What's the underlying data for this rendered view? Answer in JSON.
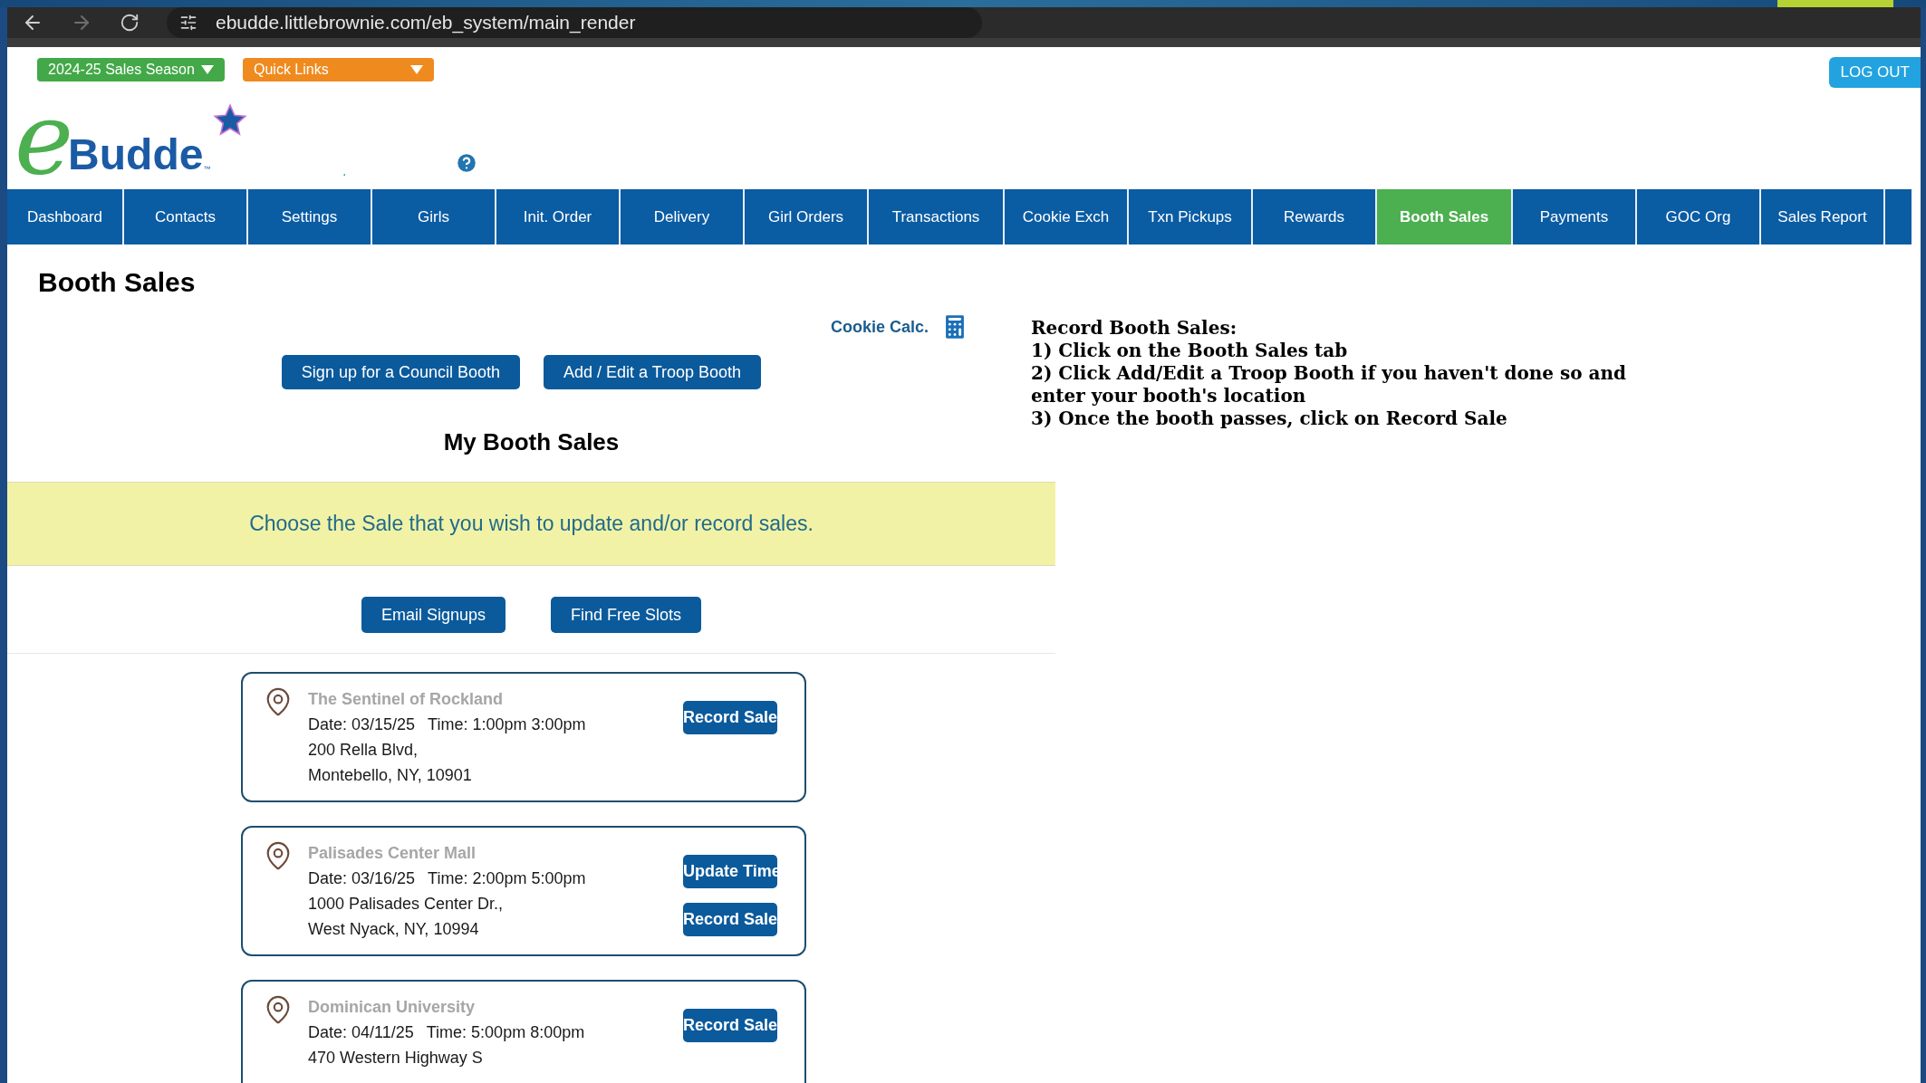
{
  "browser": {
    "url": "ebudde.littlebrownie.com/eb_system/main_render"
  },
  "header": {
    "season": "2024-25 Sales Season",
    "quick_links": "Quick Links",
    "logout": "LOG OUT",
    "logo_letter": "e",
    "logo_text": "Budde",
    "logo_mark": "™",
    "dot": "."
  },
  "nav": [
    {
      "label": "Dashboard",
      "selected": false
    },
    {
      "label": "Contacts",
      "selected": false
    },
    {
      "label": "Settings",
      "selected": false
    },
    {
      "label": "Girls",
      "selected": false
    },
    {
      "label": "Init. Order",
      "selected": false
    },
    {
      "label": "Delivery",
      "selected": false
    },
    {
      "label": "Girl Orders",
      "selected": false
    },
    {
      "label": "Transactions",
      "selected": false
    },
    {
      "label": "Cookie Exch",
      "selected": false
    },
    {
      "label": "Txn Pickups",
      "selected": false
    },
    {
      "label": "Rewards",
      "selected": false
    },
    {
      "label": "Booth Sales",
      "selected": true
    },
    {
      "label": "Payments",
      "selected": false
    },
    {
      "label": "GOC Org",
      "selected": false
    },
    {
      "label": "Sales Report",
      "selected": false
    }
  ],
  "page": {
    "heading": "Booth Sales",
    "cookie_calc": "Cookie Calc.",
    "action_buttons": [
      "Sign up for a Council Booth",
      "Add / Edit a Troop Booth"
    ],
    "section_title": "My Booth Sales",
    "notice": "Choose the Sale that you wish to update and/or record sales.",
    "list_buttons": [
      "Email Signups",
      "Find Free Slots"
    ],
    "booths": [
      {
        "name": "The Sentinel of Rockland",
        "date": "Date: 03/15/25",
        "time": "Time: 1:00pm 3:00pm",
        "address": [
          "200 Rella Blvd,",
          "Montebello, NY, 10901"
        ],
        "buttons": [
          "Record Sale"
        ]
      },
      {
        "name": "Palisades Center Mall",
        "date": "Date: 03/16/25",
        "time": "Time: 2:00pm 5:00pm",
        "address": [
          "1000 Palisades Center Dr.,",
          "West Nyack, NY, 10994"
        ],
        "buttons": [
          "Update Time",
          "Record Sale"
        ]
      },
      {
        "name": "Dominican University",
        "date": "Date: 04/11/25",
        "time": "Time: 5:00pm 8:00pm",
        "address": [
          "470 Western Highway S"
        ],
        "buttons": [
          "Record Sale"
        ]
      }
    ]
  },
  "instructions": {
    "title": "Record Booth Sales:",
    "steps": [
      "1) Click on the Booth Sales tab",
      "2) Click Add/Edit a Troop Booth if you haven't done so and enter your booth's location",
      "3) Once the booth passes, click on Record Sale"
    ]
  }
}
